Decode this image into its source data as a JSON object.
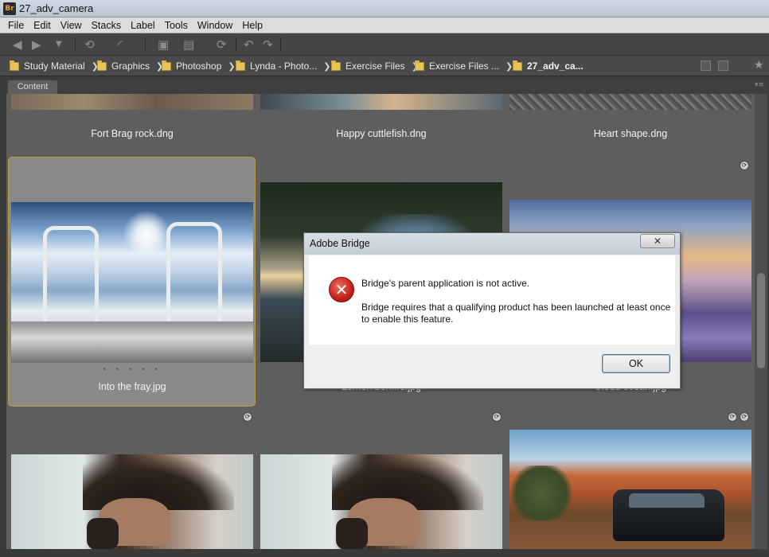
{
  "window": {
    "title": "27_adv_camera",
    "app_badge": "Br"
  },
  "menu": [
    "File",
    "Edit",
    "View",
    "Stacks",
    "Label",
    "Tools",
    "Window",
    "Help"
  ],
  "toolbar": {
    "icons": [
      "back-arrow-icon",
      "forward-arrow-icon",
      "dropdown-icon",
      "boomerang-icon",
      "refine-icon",
      "camera-icon",
      "open-recent-icon",
      "rotate-icon",
      "undo-icon",
      "redo-icon"
    ],
    "glyphs": [
      "◀",
      "▶",
      "▼",
      "⟲",
      "◜",
      "▣",
      "▤",
      "⟳",
      "↶",
      "↷"
    ]
  },
  "path": {
    "crumbs": [
      "Study Material",
      "Graphics",
      "Photoshop",
      "Lynda - Photo...",
      "Exercise Files",
      "Exercise Files ...",
      "27_adv_ca..."
    ],
    "separator": "❯",
    "favorite_glyph": "★"
  },
  "panel": {
    "tab_label": "Content",
    "menu_glyph": "▾≡"
  },
  "thumbnails": [
    {
      "label": "Fort Brag rock.dng"
    },
    {
      "label": "Happy cuttlefish.dng"
    },
    {
      "label": "Heart shape.dng"
    },
    {
      "label": "Into the fray.jpg",
      "rating": "• • • • •"
    },
    {
      "label": "Lemon bonfire.jpg"
    },
    {
      "label": "Cloud ocean.jpg"
    }
  ],
  "rotate_glyph": "⟳",
  "dialog": {
    "title": "Adobe Bridge",
    "close_glyph": "✕",
    "error_glyph": "✕",
    "message_title": "Bridge's parent application is not active.",
    "message_body": "Bridge requires that a qualifying product has been launched at least once to enable this feature.",
    "ok_label": "OK"
  }
}
